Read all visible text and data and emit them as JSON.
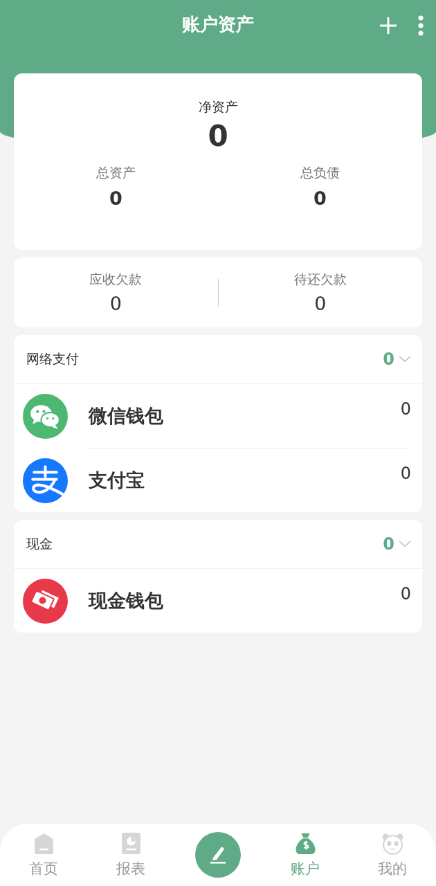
{
  "header": {
    "title": "账户资产"
  },
  "summary": {
    "net_label": "净资产",
    "net_value": "0",
    "items": [
      {
        "label": "总资产",
        "value": "0"
      },
      {
        "label": "总负债",
        "value": "0"
      }
    ]
  },
  "debts": [
    {
      "label": "应收欠款",
      "value": "0"
    },
    {
      "label": "待还欠款",
      "value": "0"
    }
  ],
  "groups": [
    {
      "title": "网络支付",
      "total": "0",
      "accounts": [
        {
          "kind": "wechat",
          "name": "微信钱包",
          "balance": "0"
        },
        {
          "kind": "alipay",
          "name": "支付宝",
          "balance": "0"
        }
      ]
    },
    {
      "title": "现金",
      "total": "0",
      "accounts": [
        {
          "kind": "cash",
          "name": "现金钱包",
          "balance": "0"
        }
      ]
    }
  ],
  "tabs": [
    {
      "kind": "home",
      "label": "首页",
      "selected": false
    },
    {
      "kind": "report",
      "label": "报表",
      "selected": false
    },
    {
      "kind": "record",
      "selected": false
    },
    {
      "kind": "account",
      "label": "账户",
      "selected": true
    },
    {
      "kind": "mine",
      "label": "我的",
      "selected": false
    }
  ]
}
